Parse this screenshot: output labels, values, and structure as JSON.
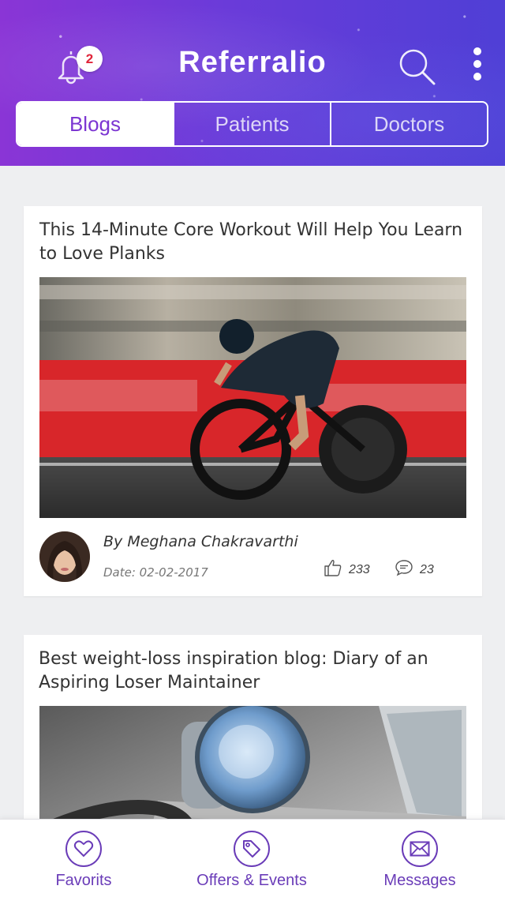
{
  "header": {
    "app_title": "Referralio",
    "notification_count": "2",
    "icons": {
      "notifications": "bell-icon",
      "search": "search-icon",
      "more": "more-vertical-icon"
    },
    "gradient_colors": [
      "#8a35d6",
      "#4f3fd6"
    ]
  },
  "tabs": [
    {
      "label": "Blogs",
      "active": true
    },
    {
      "label": "Patients",
      "active": false
    },
    {
      "label": "Doctors",
      "active": false
    }
  ],
  "posts": [
    {
      "title": "This 14-Minute Core Workout Will Help You Learn to Love Planks",
      "image": "cyclist-racing-photo",
      "author": "By Meghana Chakravarthi",
      "date": "Date: 02-02-2017",
      "likes": "233",
      "comments": "23"
    },
    {
      "title": "Best weight-loss inspiration blog: Diary of an Aspiring Loser Maintainer",
      "image": "stethoscope-laptop-photo"
    }
  ],
  "bottom_nav": [
    {
      "label": "Favorits",
      "icon": "heart-icon"
    },
    {
      "label": "Offers & Events",
      "icon": "tag-icon"
    },
    {
      "label": "Messages",
      "icon": "envelope-icon"
    }
  ],
  "colors": {
    "accent": "#7c36d2",
    "nav_purple": "#6a3cb8",
    "badge_red": "#e0243a"
  }
}
